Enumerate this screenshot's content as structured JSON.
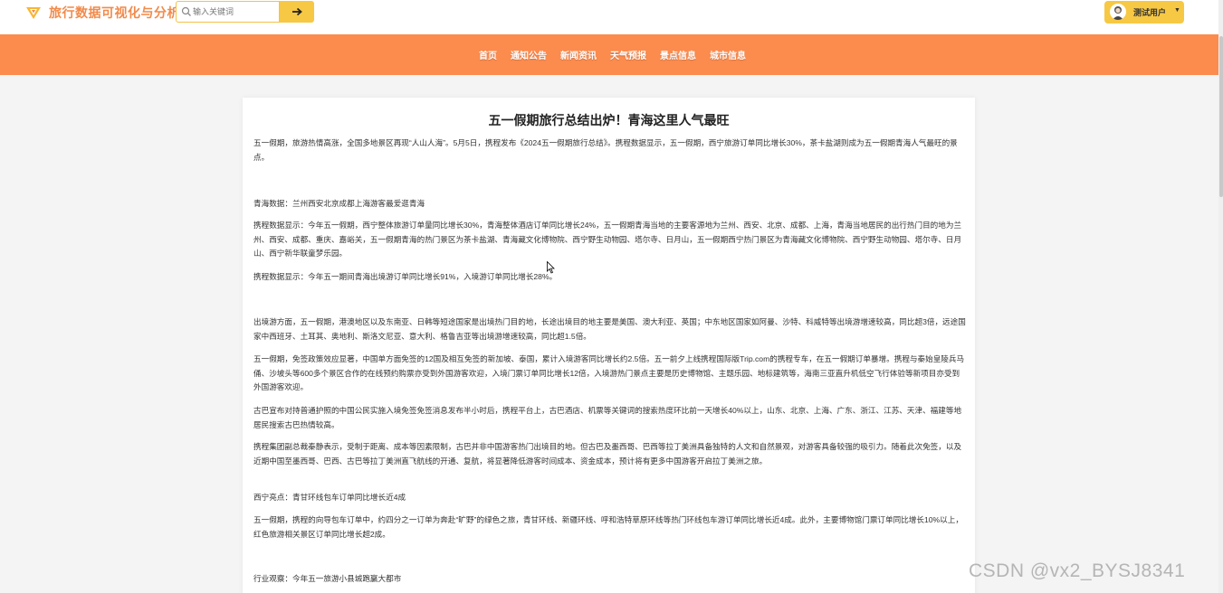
{
  "header": {
    "brand": "旅行数据可视化与分析",
    "search_placeholder": "输入关键词",
    "search_button_icon": "arrow-right-icon",
    "user_name": "测试用户",
    "accent_color": "#f7c843",
    "brand_color": "#f28a4a"
  },
  "nav": {
    "color": "#fc8b4e",
    "items": [
      {
        "label": "首页"
      },
      {
        "label": "通知公告"
      },
      {
        "label": "新闻资讯"
      },
      {
        "label": "天气预报"
      },
      {
        "label": "景点信息"
      },
      {
        "label": "城市信息"
      }
    ]
  },
  "article": {
    "title": "五一假期旅行总结出炉！青海这里人气最旺",
    "paragraphs": [
      "五一假期，旅游热情高涨，全国多地景区再现“人山人海”。5月5日，携程发布《2024五一假期旅行总结》。携程数据显示，五一假期，西宁旅游订单同比增长30%，茶卡盐湖则成为五一假期青海人气最旺的景点。",
      "青海数据：兰州西安北京成都上海游客最爱逛青海",
      "携程数据显示：今年五一假期，西宁整体旅游订单量同比增长30%，青海整体酒店订单同比增长24%，五一假期青海当地的主要客源地为兰州、西安、北京、成都、上海，青海当地居民的出行热门目的地为兰州、西安、成都、重庆、嘉峪关，五一假期青海的热门景区为茶卡盐湖、青海藏文化博物院、西宁野生动物园、塔尔寺、日月山，五一假期西宁热门景区为青海藏文化博物院、西宁野生动物园、塔尔寺、日月山、西宁新华联童梦乐园。",
      "携程数据显示：今年五一期间青海出境游订单同比增长91%，入境游订单同比增长28%。",
      "出境游方面，五一假期，港澳地区以及东南亚、日韩等短途国家是出境热门目的地，长途出境目的地主要是美国、澳大利亚、英国；中东地区国家如阿曼、沙特、科威特等出境游增速较高，同比超3倍，远途国家中西班牙、土耳其、奥地利、斯洛文尼亚、意大利、格鲁吉亚等出境游增速较高，同比超1.5倍。",
      "五一假期，免签政策效应显著，中国单方面免签的12国及相互免签的新加坡、泰国，累计入境游客同比增长约2.5倍。五一前夕上线携程国际版Trip.com的携程专车，在五一假期订单暴增。携程与秦始皇陵兵马俑、沙坡头等600多个景区合作的在线预约购票亦受到外国游客欢迎，入境门票订单同比增长12倍，入境游热门景点主要是历史博物馆、主题乐园、地标建筑等，海南三亚直升机低空飞行体验等新项目亦受到外国游客欢迎。",
      "古巴宣布对持普通护照的中国公民实施入境免签免签消息发布半小时后，携程平台上，古巴酒店、机票等关键词的搜索热度环比前一天增长40%以上，山东、北京、上海、广东、浙江、江苏、天津、福建等地居民搜索古巴热情较高。",
      "携程集团副总裁秦静表示，受制于距离、成本等因素限制，古巴并非中国游客热门出境目的地。但古巴及墨西哥、巴西等拉丁美洲具备独特的人文和自然景观，对游客具备较强的吸引力。随着此次免签，以及近期中国至墨西哥、巴西、古巴等拉丁美洲直飞航线的开通、复航，将显著降低游客时间成本、资金成本，预计将有更多中国游客开启拉丁美洲之旅。",
      "西宁亮点：青甘环线包车订单同比增长近4成",
      "五一假期，携程的向导包车订单中，约四分之一订单为奔赴“旷野”的绿色之旅，青甘环线、新疆环线、呼和浩特草原环线等热门环线包车游订单同比增长近4成。此外，主要博物馆门票订单同比增长10%以上，红色旅游相关景区订单同比增长超2成。",
      "行业观察：今年五一旅游小县城跑赢大都市"
    ]
  },
  "watermark": "CSDN @vx2_BYSJ8341"
}
